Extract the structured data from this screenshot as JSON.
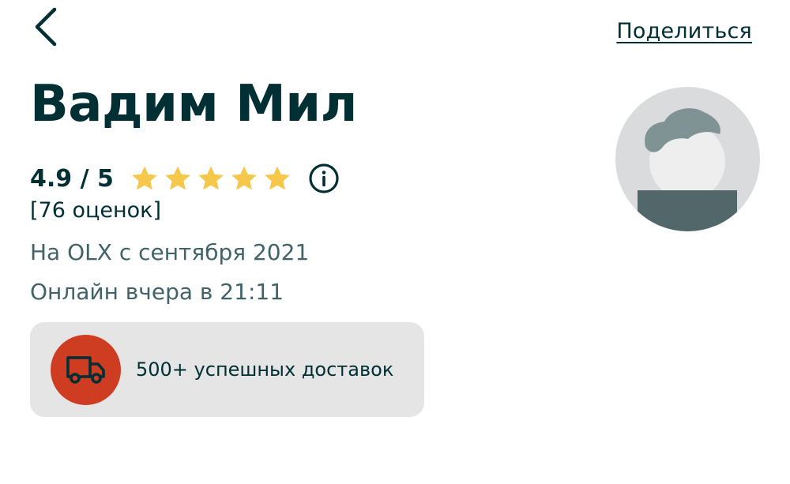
{
  "header": {
    "back_icon": "chevron-left-icon",
    "share_label": "Поделиться"
  },
  "profile": {
    "name": "Вадим Мил",
    "rating_text": "4.9 / 5",
    "rating_value": 4.9,
    "rating_max": 5,
    "stars_filled": 5,
    "star_color": "#f5c84c",
    "info_icon": "info-icon",
    "ratings_count": "[76 оценок]",
    "member_since": "На OLX с сентября 2021",
    "last_online": "Онлайн вчера в 21:11",
    "avatar_icon": "default-avatar-icon"
  },
  "delivery": {
    "icon": "truck-icon",
    "icon_bg_color": "#ce3d21",
    "label": "500+ успешных доставок"
  }
}
